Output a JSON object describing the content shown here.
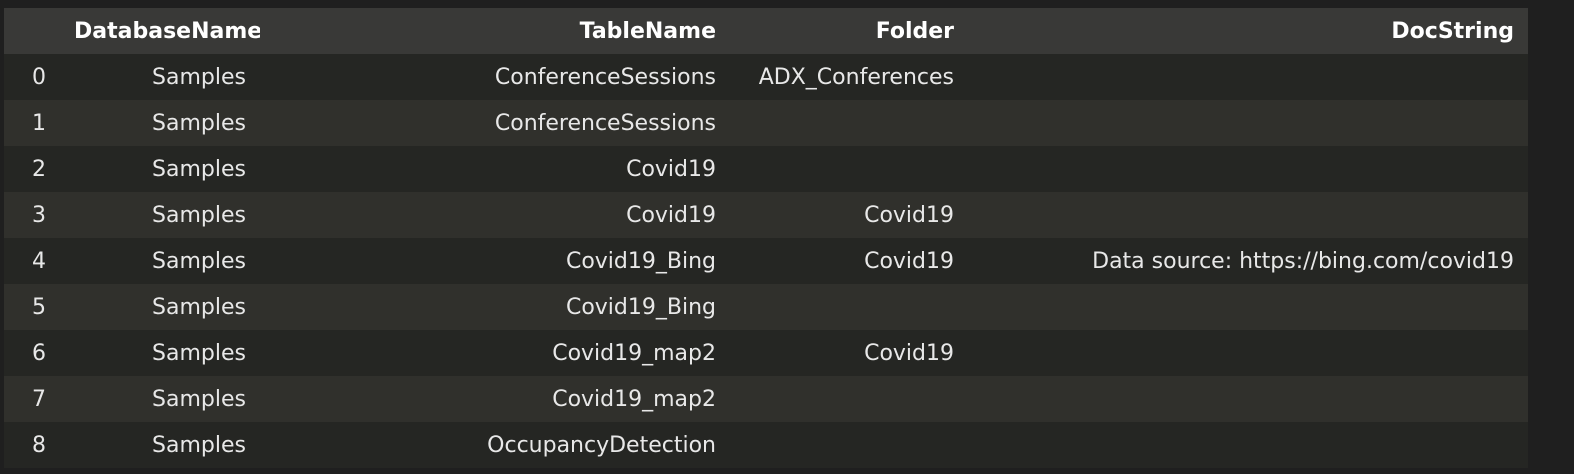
{
  "table": {
    "columns": [
      "",
      "DatabaseName",
      "TableName",
      "Folder",
      "DocString"
    ],
    "rows": [
      {
        "index": "0",
        "database": "Samples",
        "table": "ConferenceSessions",
        "folder": "ADX_Conferences",
        "docstring": ""
      },
      {
        "index": "1",
        "database": "Samples",
        "table": "ConferenceSessions",
        "folder": "",
        "docstring": ""
      },
      {
        "index": "2",
        "database": "Samples",
        "table": "Covid19",
        "folder": "",
        "docstring": ""
      },
      {
        "index": "3",
        "database": "Samples",
        "table": "Covid19",
        "folder": "Covid19",
        "docstring": ""
      },
      {
        "index": "4",
        "database": "Samples",
        "table": "Covid19_Bing",
        "folder": "Covid19",
        "docstring": "Data source: https://bing.com/covid19"
      },
      {
        "index": "5",
        "database": "Samples",
        "table": "Covid19_Bing",
        "folder": "",
        "docstring": ""
      },
      {
        "index": "6",
        "database": "Samples",
        "table": "Covid19_map2",
        "folder": "Covid19",
        "docstring": ""
      },
      {
        "index": "7",
        "database": "Samples",
        "table": "Covid19_map2",
        "folder": "",
        "docstring": ""
      },
      {
        "index": "8",
        "database": "Samples",
        "table": "OccupancyDetection",
        "folder": "",
        "docstring": ""
      }
    ]
  }
}
